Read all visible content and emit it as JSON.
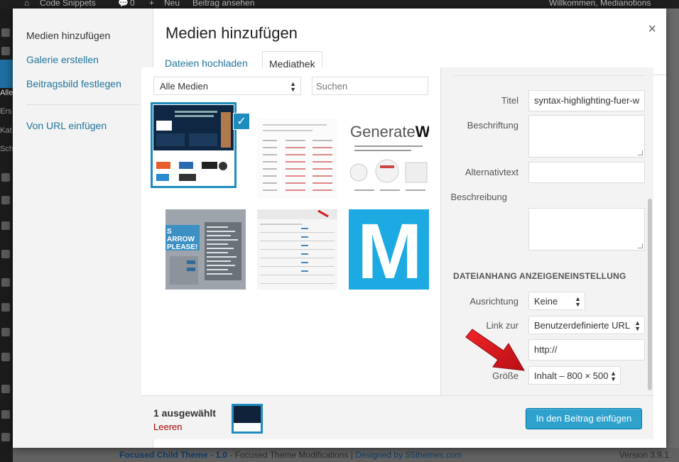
{
  "adminbar": {
    "site": "Code Snippets",
    "comments": "0",
    "new": "Neu",
    "view": "Beitrag ansehen",
    "greeting": "Willkommen, Medianotions"
  },
  "leftnav": {
    "labels": [
      "Alle",
      "Ers",
      "Kat",
      "Sch"
    ]
  },
  "footer": {
    "theme": "Focused Child Theme - 1.0",
    "mid": " - Focused Theme Modifications | ",
    "designer": "Designed by S5themes.com",
    "version": "Version 3.9.1"
  },
  "menu": {
    "items": [
      "Medien hinzufügen",
      "Galerie erstellen",
      "Beitragsbild festlegen",
      "Von URL einfügen"
    ]
  },
  "modal": {
    "title": "Medien hinzufügen",
    "close": "×"
  },
  "tabs": [
    "Dateien hochladen",
    "Mediathek"
  ],
  "filter": {
    "selected": "Alle Medien",
    "search_placeholder": "Suchen"
  },
  "thumbs": {
    "t3_logo_a": "Generate",
    "t3_logo_b": "W",
    "t4_text": "S ARROW PLEASE!",
    "t6_letter": "M"
  },
  "details": {
    "title_label": "Titel",
    "title_value": "syntax-highlighting-fuer-w",
    "caption_label": "Beschriftung",
    "alt_label": "Alternativtext",
    "description_label": "Beschreibung",
    "section_heading": "DATEIANHANG ANZEIGENEINSTELLUNG",
    "align_label": "Ausrichtung",
    "align_value": "Keine",
    "link_label": "Link zur",
    "link_value": "Benutzerdefinierte URL",
    "url_value": "http://",
    "size_label": "Größe",
    "size_value": "Inhalt – 800 × 500"
  },
  "toolbar": {
    "selected_count": "1 ausgewählt",
    "clear": "Leeren",
    "insert": "In den Beitrag einfügen"
  },
  "colors": {
    "accent": "#1e8cbe",
    "button": "#2ea2cc",
    "arrow": "#e2151b"
  }
}
